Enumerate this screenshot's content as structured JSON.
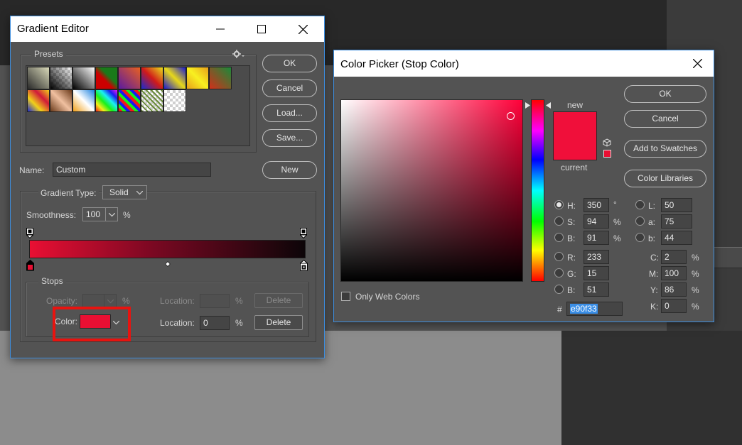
{
  "gradient_editor": {
    "title": "Gradient Editor",
    "presets_label": "Presets",
    "buttons": {
      "ok": "OK",
      "cancel": "Cancel",
      "load": "Load...",
      "save": "Save...",
      "new": "New"
    },
    "name_label": "Name:",
    "name_value": "Custom",
    "gradient_type_label": "Gradient Type:",
    "gradient_type_value": "Solid",
    "smoothness_label": "Smoothness:",
    "smoothness_value": "100",
    "percent": "%",
    "stops_label": "Stops",
    "opacity_label": "Opacity:",
    "location_label": "Location:",
    "delete_label": "Delete",
    "color_label": "Color:",
    "color_location_value": "0",
    "stop_color": "#e90f33"
  },
  "color_picker": {
    "title": "Color Picker (Stop Color)",
    "new_label": "new",
    "current_label": "current",
    "buttons": {
      "ok": "OK",
      "cancel": "Cancel",
      "add_to_swatches": "Add to Swatches",
      "color_libraries": "Color Libraries"
    },
    "only_web_colors": "Only Web Colors",
    "hsb": [
      {
        "label": "H:",
        "value": "350",
        "unit": "°"
      },
      {
        "label": "S:",
        "value": "94",
        "unit": "%"
      },
      {
        "label": "B:",
        "value": "91",
        "unit": "%"
      }
    ],
    "rgb": [
      {
        "label": "R:",
        "value": "233"
      },
      {
        "label": "G:",
        "value": "15"
      },
      {
        "label": "B:",
        "value": "51"
      }
    ],
    "lab": [
      {
        "label": "L:",
        "value": "50"
      },
      {
        "label": "a:",
        "value": "75"
      },
      {
        "label": "b:",
        "value": "44"
      }
    ],
    "cmyk": [
      {
        "label": "C:",
        "value": "2",
        "unit": "%"
      },
      {
        "label": "M:",
        "value": "100",
        "unit": "%"
      },
      {
        "label": "Y:",
        "value": "86",
        "unit": "%"
      },
      {
        "label": "K:",
        "value": "0",
        "unit": "%"
      }
    ],
    "hex_label": "#",
    "hex_value": "e90f33",
    "new_color": "#f00f3a",
    "current_color": "#f00f3a",
    "hue_color": "#ff0039"
  },
  "icons": [
    "close-icon",
    "maximize-icon",
    "minimize-icon",
    "gear-icon",
    "chevron-down-icon",
    "cube-icon"
  ]
}
